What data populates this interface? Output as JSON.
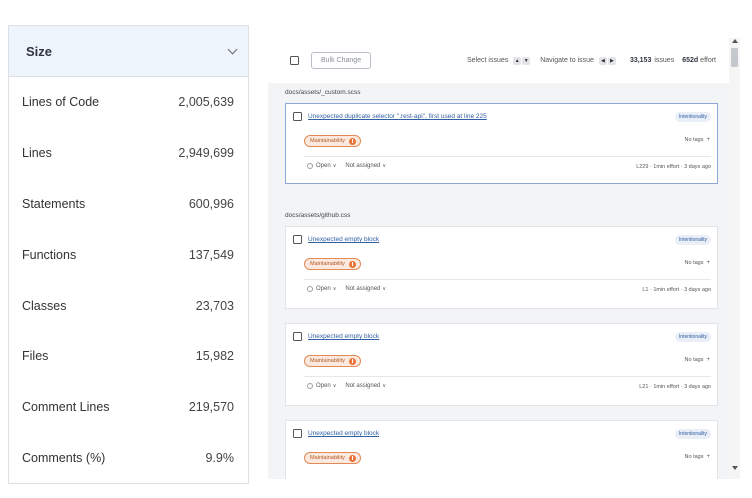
{
  "size_panel": {
    "title": "Size",
    "metrics": [
      {
        "label": "Lines of Code",
        "value": "2,005,639"
      },
      {
        "label": "Lines",
        "value": "2,949,699"
      },
      {
        "label": "Statements",
        "value": "600,996"
      },
      {
        "label": "Functions",
        "value": "137,549"
      },
      {
        "label": "Classes",
        "value": "23,703"
      },
      {
        "label": "Files",
        "value": "15,982"
      },
      {
        "label": "Comment Lines",
        "value": "219,570"
      },
      {
        "label": "Comments (%)",
        "value": "9.9%"
      }
    ]
  },
  "toolbar": {
    "bulk_change": "Bulk Change",
    "select_issues": "Select issues",
    "navigate_to_issue": "Navigate to issue",
    "issue_count": "33,153",
    "issue_count_label": "issues",
    "effort": "652d",
    "effort_label": "effort"
  },
  "issue_groups": [
    {
      "file": "docs/assets/_custom.scss",
      "issues": [
        {
          "title": "Unexpected duplicate selector \".rest-api\", first used at line 225",
          "tag": "Intentionality",
          "category": "Maintainability",
          "tags": "No tags",
          "status": "Open",
          "assignee": "Not assigned",
          "meta": "L229 · 1min effort · 3 days ago"
        }
      ]
    },
    {
      "file": "docs/assets/github.css",
      "issues": [
        {
          "title": "Unexpected empty block",
          "tag": "Intentionality",
          "category": "Maintainability",
          "tags": "No tags",
          "status": "Open",
          "assignee": "Not assigned",
          "meta": "L1 · 1min effort · 3 days ago"
        },
        {
          "title": "Unexpected empty block",
          "tag": "Intentionality",
          "category": "Maintainability",
          "tags": "No tags",
          "status": "Open",
          "assignee": "Not assigned",
          "meta": "L21 · 1min effort · 3 days ago"
        },
        {
          "title": "Unexpected empty block",
          "tag": "Intentionality",
          "category": "Maintainability",
          "tags": "No tags"
        }
      ]
    }
  ]
}
